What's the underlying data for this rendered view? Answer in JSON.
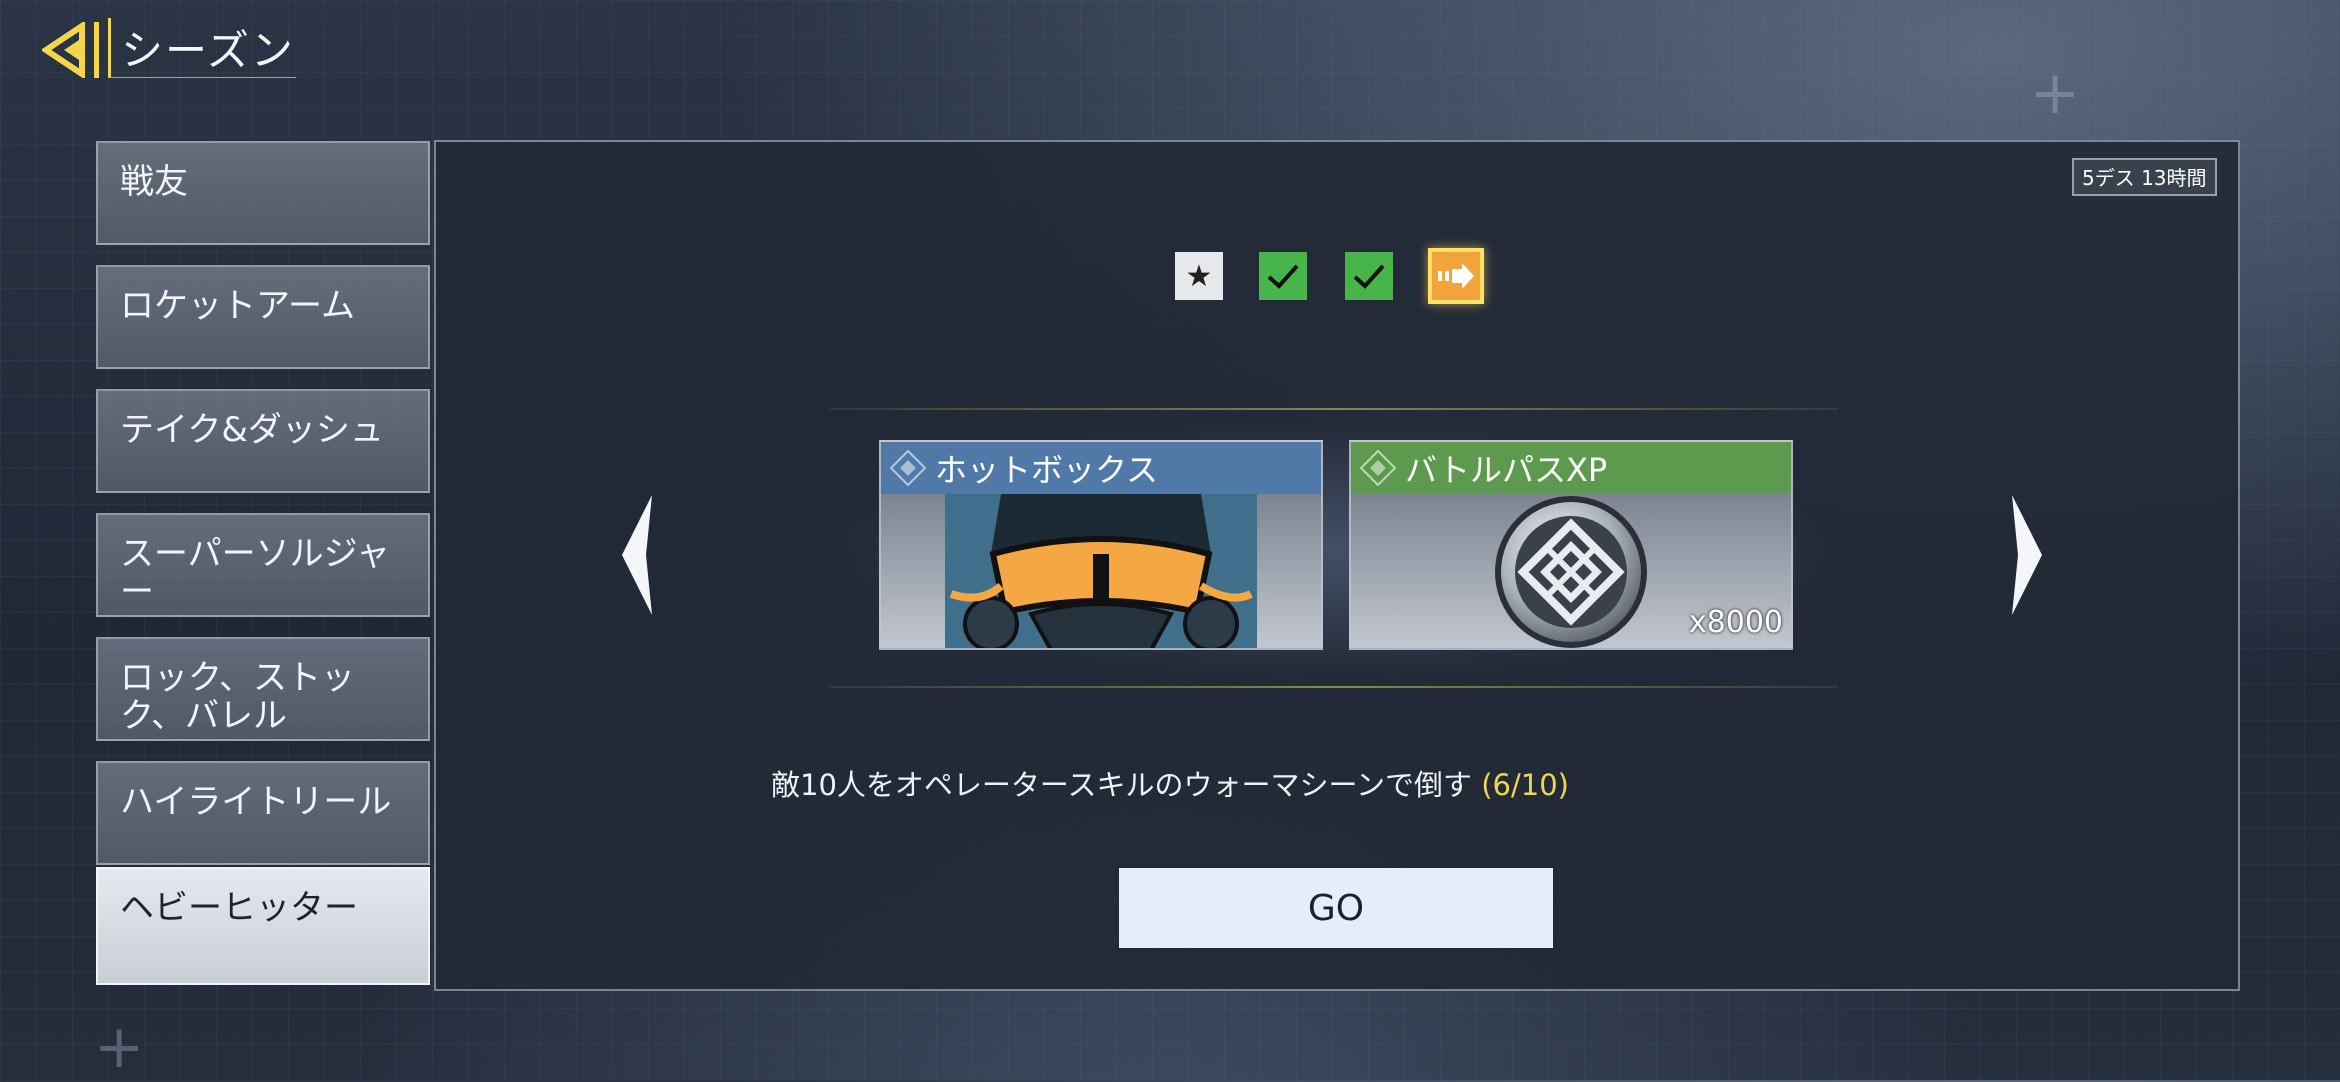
{
  "header": {
    "title": "シーズン"
  },
  "timer": {
    "text": "5デス 13時間"
  },
  "sidebar": {
    "items": [
      {
        "label": "戦友"
      },
      {
        "label": "ロケットアーム"
      },
      {
        "label": "テイク&ダッシュ"
      },
      {
        "label": "スーパーソルジャー"
      },
      {
        "label": "ロック、ストック、バレル"
      },
      {
        "label": "ハイライトリール"
      },
      {
        "label": "ヘビーヒッター",
        "active": true
      }
    ]
  },
  "progress": {
    "steps": [
      "star",
      "complete",
      "complete",
      "current"
    ]
  },
  "rewards": [
    {
      "name": "ホットボックス",
      "header_color": "#5079a8",
      "icon": "diamond-icon",
      "image": "gas-mask-spray"
    },
    {
      "name": "バトルパスXP",
      "header_color": "#5d9a4e",
      "icon": "diamond-icon",
      "image": "battle-pass-emblem",
      "quantity": "x8000"
    }
  ],
  "quest": {
    "description": "敵10人をオペレータースキルのウォーマシーンで倒す",
    "progress": "(6/10)"
  },
  "go_button": {
    "label": "GO"
  },
  "colors": {
    "accent": "#f3d64a",
    "check": "#47b54a",
    "current": "#f2a43a"
  }
}
